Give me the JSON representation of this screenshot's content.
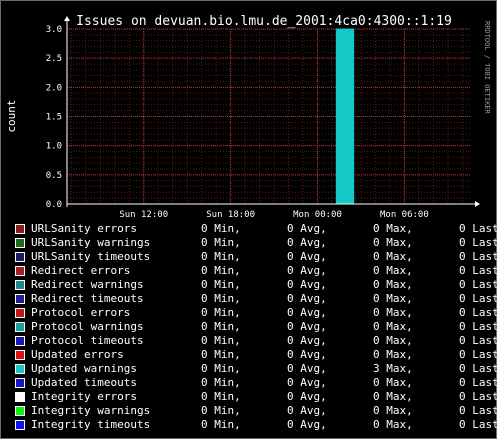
{
  "chart_data": {
    "type": "area",
    "title": "Issues on devuan.bio.lmu.de_2001:4ca0:4300::1:19",
    "ylabel": "count",
    "side_label": "RRDTOOL / TOBI OETIKER",
    "ylim": [
      0,
      3.0
    ],
    "y_ticks": [
      "0.0",
      "0.5",
      "1.0",
      "1.5",
      "2.0",
      "2.5",
      "3.0"
    ],
    "x_tick_labels": [
      "Sun 12:00",
      "Sun 18:00",
      "Mon 00:00",
      "Mon 06:00"
    ],
    "x_axis_span_hours": [
      6.7,
      34.6
    ],
    "x_tick_hours": [
      12,
      18,
      24,
      30
    ],
    "grid": true,
    "series": [
      {
        "name": "Updated warnings",
        "color": "#14c8c8",
        "points": [
          [
            25.3,
            0
          ],
          [
            25.3,
            3
          ],
          [
            26.5,
            3
          ],
          [
            26.5,
            0
          ]
        ]
      }
    ]
  },
  "legend": {
    "rows": [
      {
        "label": "URLSanity errors",
        "color": "#8b1a1a",
        "min": "0 Min,",
        "avg": "0 Avg,",
        "max": "0 Max,",
        "last": "0 Last"
      },
      {
        "label": "URLSanity warnings",
        "color": "#1a6b1a",
        "min": "0 Min,",
        "avg": "0 Avg,",
        "max": "0 Max,",
        "last": "0 Last"
      },
      {
        "label": "URLSanity timeouts",
        "color": "#1a1a6b",
        "min": "0 Min,",
        "avg": "0 Avg,",
        "max": "0 Max,",
        "last": "0 Last"
      },
      {
        "label": "Redirect errors",
        "color": "#a52020",
        "min": "0 Min,",
        "avg": "0 Avg,",
        "max": "0 Max,",
        "last": "0 Last"
      },
      {
        "label": "Redirect warnings",
        "color": "#208888",
        "min": "0 Min,",
        "avg": "0 Avg,",
        "max": "0 Max,",
        "last": "0 Last"
      },
      {
        "label": "Redirect timeouts",
        "color": "#20208f",
        "min": "0 Min,",
        "avg": "0 Avg,",
        "max": "0 Max,",
        "last": "0 Last"
      },
      {
        "label": "Protocol errors",
        "color": "#c01818",
        "min": "0 Min,",
        "avg": "0 Avg,",
        "max": "0 Max,",
        "last": "0 Last"
      },
      {
        "label": "Protocol warnings",
        "color": "#18a0a0",
        "min": "0 Min,",
        "avg": "0 Avg,",
        "max": "0 Max,",
        "last": "0 Last"
      },
      {
        "label": "Protocol timeouts",
        "color": "#1818b0",
        "min": "0 Min,",
        "avg": "0 Avg,",
        "max": "0 Max,",
        "last": "0 Last"
      },
      {
        "label": "Updated errors",
        "color": "#e01010",
        "min": "0 Min,",
        "avg": "0 Avg,",
        "max": "0 Max,",
        "last": "0 Last"
      },
      {
        "label": "Updated warnings",
        "color": "#14c8c8",
        "min": "0 Min,",
        "avg": "0 Avg,",
        "max": "3 Max,",
        "last": "0 Last"
      },
      {
        "label": "Updated timeouts",
        "color": "#1414d0",
        "min": "0 Min,",
        "avg": "0 Avg,",
        "max": "0 Max,",
        "last": "0 Last"
      },
      {
        "label": "Integrity errors",
        "color": "#ffffff",
        "min": "0 Min,",
        "avg": "0 Avg,",
        "max": "0 Max,",
        "last": "0 Last"
      },
      {
        "label": "Integrity warnings",
        "color": "#10f010",
        "min": "0 Min,",
        "avg": "0 Avg,",
        "max": "0 Max,",
        "last": "0 Last"
      },
      {
        "label": "Integrity timeouts",
        "color": "#1010ff",
        "min": "0 Min,",
        "avg": "0 Avg,",
        "max": "0 Max,",
        "last": "0 Last"
      }
    ]
  }
}
